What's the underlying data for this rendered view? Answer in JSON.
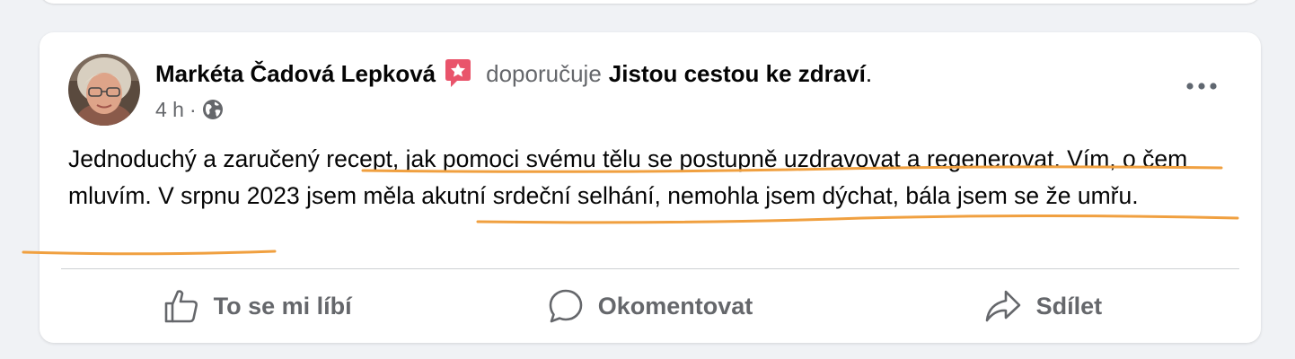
{
  "post": {
    "author": "Markéta Čadová Lepková",
    "recommends_verb": "doporučuje",
    "page_name": "Jistou cestou ke zdraví",
    "page_suffix": ".",
    "time": "4 h",
    "separator": "·",
    "audience_icon": "globe-icon",
    "recommend_badge_icon": "recommend-star-icon",
    "more_icon": "more-options-icon",
    "text": "Jednoduchý a zaručený recept, jak pomoci svému tělu se postupně uzdravovat a regenerovat. Vím, o čem mluvím. V srpnu 2023 jsem měla akutní srdeční selhání, nemohla jsem dýchat, bála jsem se že umřu."
  },
  "actions": {
    "like_label": "To se mi líbí",
    "like_icon": "thumbs-up-icon",
    "comment_label": "Okomentovat",
    "comment_icon": "comment-bubble-icon",
    "share_label": "Sdílet",
    "share_icon": "share-arrow-icon"
  },
  "colors": {
    "background": "#f0f2f5",
    "card": "#ffffff",
    "text_primary": "#050505",
    "text_secondary": "#65676b",
    "recommend_badge": "#e9546b",
    "annotation_underline": "#f0a040"
  }
}
